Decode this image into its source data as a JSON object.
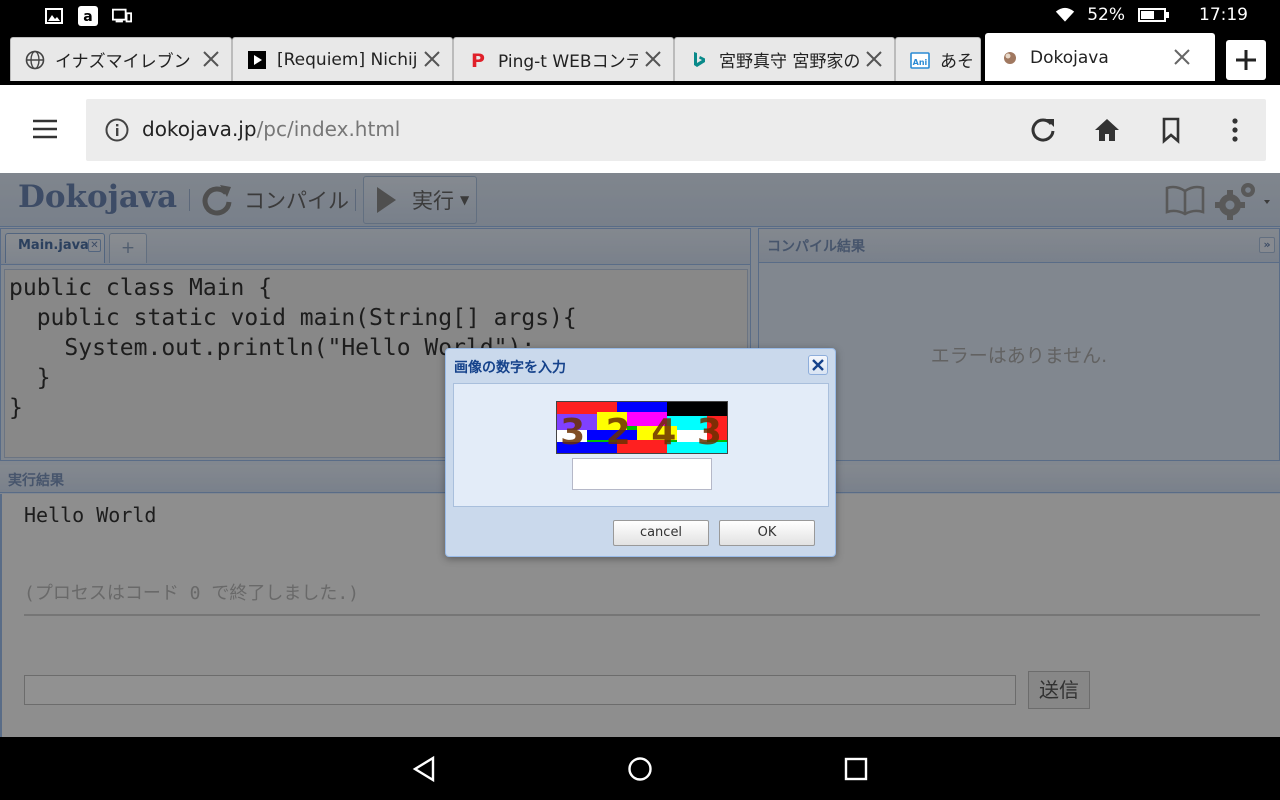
{
  "status_bar": {
    "battery": "52%",
    "time": "17:19"
  },
  "tabs": [
    {
      "title": "イナズマイレブン",
      "favicon": "globe-icon"
    },
    {
      "title": "[Requiem] Nichijou",
      "favicon": "play-icon"
    },
    {
      "title": "Ping-t WEBコンテンツ",
      "favicon": "ping-t-icon"
    },
    {
      "title": "宮野真守 宮野家の",
      "favicon": "bing-icon"
    },
    {
      "title": "あそ",
      "favicon": "anime-icon"
    },
    {
      "title": "Dokojava",
      "favicon": "dokojava-icon",
      "active": true
    }
  ],
  "address": {
    "host": "dokojava.jp",
    "path": "/pc/index.html"
  },
  "app": {
    "logo": "Dokojava",
    "compile_label": "コンパイル",
    "run_label": "実行"
  },
  "editor": {
    "file_tab": "Main.java",
    "add_tab": "+",
    "code": "public class Main {\n  public static void main(String[] args){\n    System.out.println(\"Hello World\");\n  }\n}"
  },
  "compile_result": {
    "title": "コンパイル結果",
    "collapse": "»",
    "message": "エラーはありません."
  },
  "run_result": {
    "title": "実行結果",
    "output": "Hello World",
    "exit_message": "(プロセスはコード 0 で終了しました.)",
    "send_label": "送信"
  },
  "dialog": {
    "title": "画像の数字を入力",
    "captcha_text": "3 2 4 3",
    "cancel_label": "cancel",
    "ok_label": "OK"
  },
  "colors": {
    "accent": "#99bbe8",
    "logo": "#6a84b0",
    "panel_bg": "#dfe8f6"
  }
}
